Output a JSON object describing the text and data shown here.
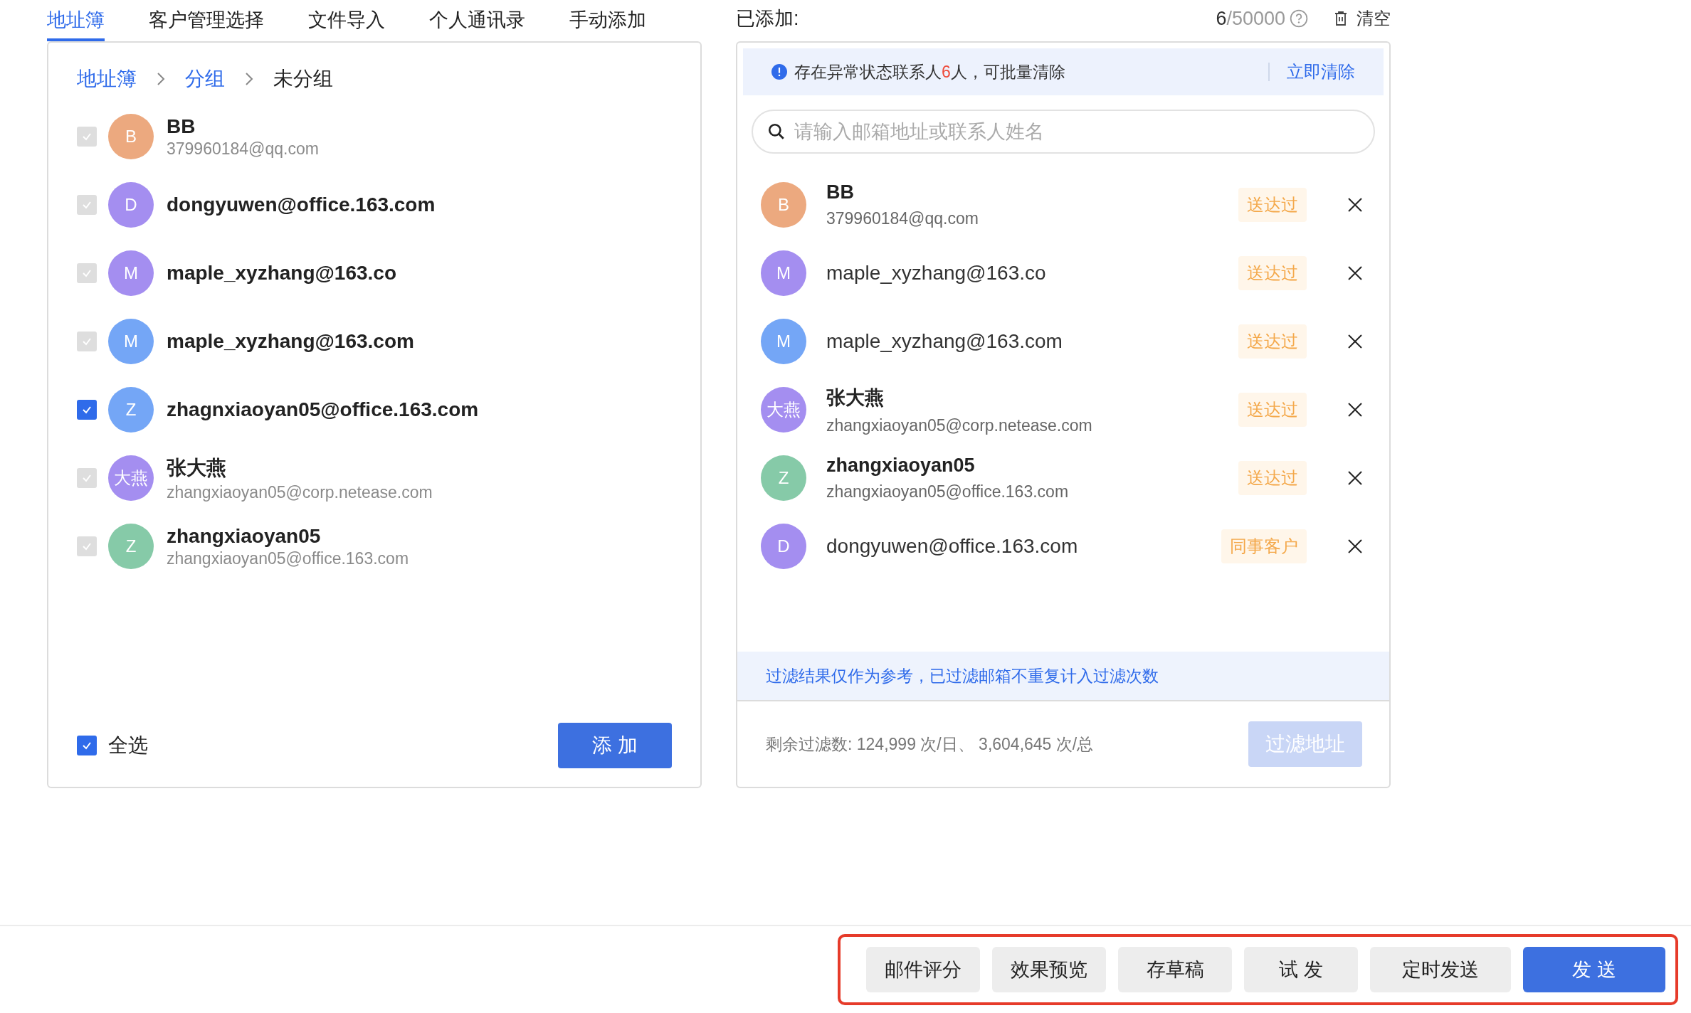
{
  "tabs": [
    {
      "label": "地址簿",
      "selected": true
    },
    {
      "label": "客户管理选择",
      "selected": false
    },
    {
      "label": "文件导入",
      "selected": false
    },
    {
      "label": "个人通讯录",
      "selected": false
    },
    {
      "label": "手动添加",
      "selected": false
    }
  ],
  "breadcrumb": [
    {
      "label": "地址簿",
      "link": true
    },
    {
      "label": "分组",
      "link": true
    },
    {
      "label": "未分组",
      "link": false
    }
  ],
  "contacts": [
    {
      "avatar": "B",
      "color": "#eca97f",
      "name": "BB",
      "email": "379960184@qq.com",
      "checked": true,
      "disabled": true
    },
    {
      "avatar": "D",
      "color": "#a48ef0",
      "email": "dongyuwen@office.163.com",
      "checked": true,
      "disabled": true
    },
    {
      "avatar": "M",
      "color": "#a48ef0",
      "email": "maple_xyzhang@163.co",
      "checked": true,
      "disabled": true
    },
    {
      "avatar": "M",
      "color": "#74a6f6",
      "email": "maple_xyzhang@163.com",
      "checked": true,
      "disabled": true
    },
    {
      "avatar": "Z",
      "color": "#74a6f6",
      "email": "zhagnxiaoyan05@office.163.com",
      "checked": true,
      "disabled": false
    },
    {
      "avatar": "大燕",
      "color": "#a48ef0",
      "name": "张大燕",
      "email": "zhangxiaoyan05@corp.netease.com",
      "checked": true,
      "disabled": true
    },
    {
      "avatar": "Z",
      "color": "#86caa8",
      "name": "zhangxiaoyan05",
      "email": "zhangxiaoyan05@office.163.com",
      "checked": true,
      "disabled": true
    }
  ],
  "select_all": {
    "label": "全选",
    "checked": true
  },
  "add_button": "添 加",
  "added": {
    "label": "已添加:",
    "count": "6",
    "limit": "/50000",
    "clear_button": "清空"
  },
  "notice": {
    "text_before": "存在异常状态联系人",
    "count": "6",
    "text_after": "人，可批量清除",
    "action": "立即清除"
  },
  "search": {
    "placeholder": "请输入邮箱地址或联系人姓名"
  },
  "recipients": [
    {
      "avatar": "B",
      "color": "#eca97f",
      "name": "BB",
      "email": "379960184@qq.com",
      "tag": "送达过"
    },
    {
      "avatar": "M",
      "color": "#a48ef0",
      "email": "maple_xyzhang@163.co",
      "tag": "送达过"
    },
    {
      "avatar": "M",
      "color": "#74a6f6",
      "email": "maple_xyzhang@163.com",
      "tag": "送达过"
    },
    {
      "avatar": "大燕",
      "color": "#a48ef0",
      "name": "张大燕",
      "email": "zhangxiaoyan05@corp.netease.com",
      "tag": "送达过"
    },
    {
      "avatar": "Z",
      "color": "#86caa8",
      "name": "zhangxiaoyan05",
      "email": "zhangxiaoyan05@office.163.com",
      "tag": "送达过"
    },
    {
      "avatar": "D",
      "color": "#a48ef0",
      "email": "dongyuwen@office.163.com",
      "tag": "同事客户"
    }
  ],
  "filter_note": "过滤结果仅作为参考，已过滤邮箱不重复计入过滤次数",
  "quota": "剩余过滤数: 124,999 次/日、 3,604,645 次/总",
  "filter_button": {
    "label": "过滤地址",
    "disabled": true
  },
  "actions": [
    {
      "label": "邮件评分",
      "primary": false
    },
    {
      "label": "效果预览",
      "primary": false
    },
    {
      "label": "存草稿",
      "primary": false
    },
    {
      "label": "试 发",
      "primary": false
    },
    {
      "label": "定时发送",
      "primary": false
    },
    {
      "label": "发 送",
      "primary": true
    }
  ]
}
